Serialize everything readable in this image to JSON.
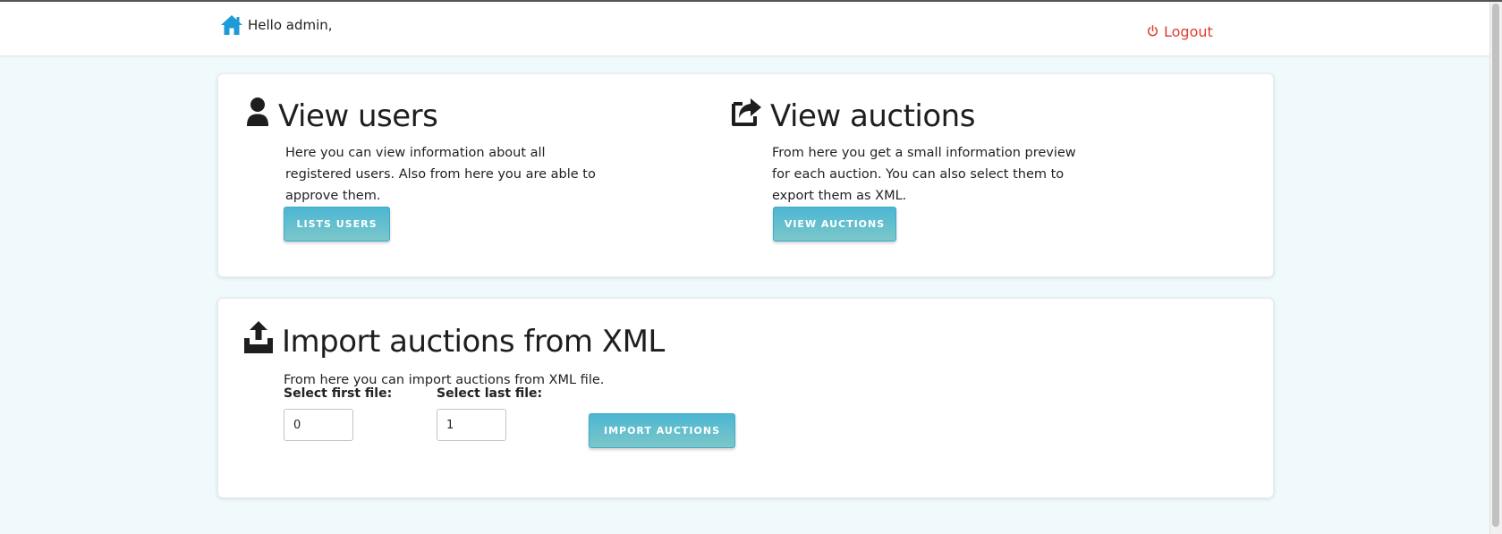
{
  "header": {
    "greeting": "Hello admin,",
    "logout_label": "Logout",
    "home_icon": "home-icon",
    "power_icon": "power-icon",
    "home_icon_color": "#1e9ad6",
    "logout_color": "#e03b2f"
  },
  "cards": {
    "users": {
      "title": "View users",
      "icon": "user-icon",
      "description": "Here you can view information about all registered users. Also from here you are able to approve them.",
      "button_label": "LISTS USERS"
    },
    "auctions": {
      "title": "View auctions",
      "icon": "share-square-icon",
      "description": "From here you get a small information preview for each auction. You can also select them to export them as XML.",
      "button_label": "VIEW AUCTIONS"
    },
    "import": {
      "title": "Import auctions from XML",
      "icon": "upload-tray-icon",
      "description": "From here you can import auctions from XML file.",
      "first_file_label": "Select first file:",
      "first_file_value": "0",
      "last_file_label": "Select last file:",
      "last_file_value": "1",
      "button_label": "IMPORT AUCTIONS"
    }
  },
  "colors": {
    "page_background": "#f0fafc",
    "button_gradient_top": "#4cb6d3",
    "button_gradient_bottom": "#7cc7c9"
  }
}
